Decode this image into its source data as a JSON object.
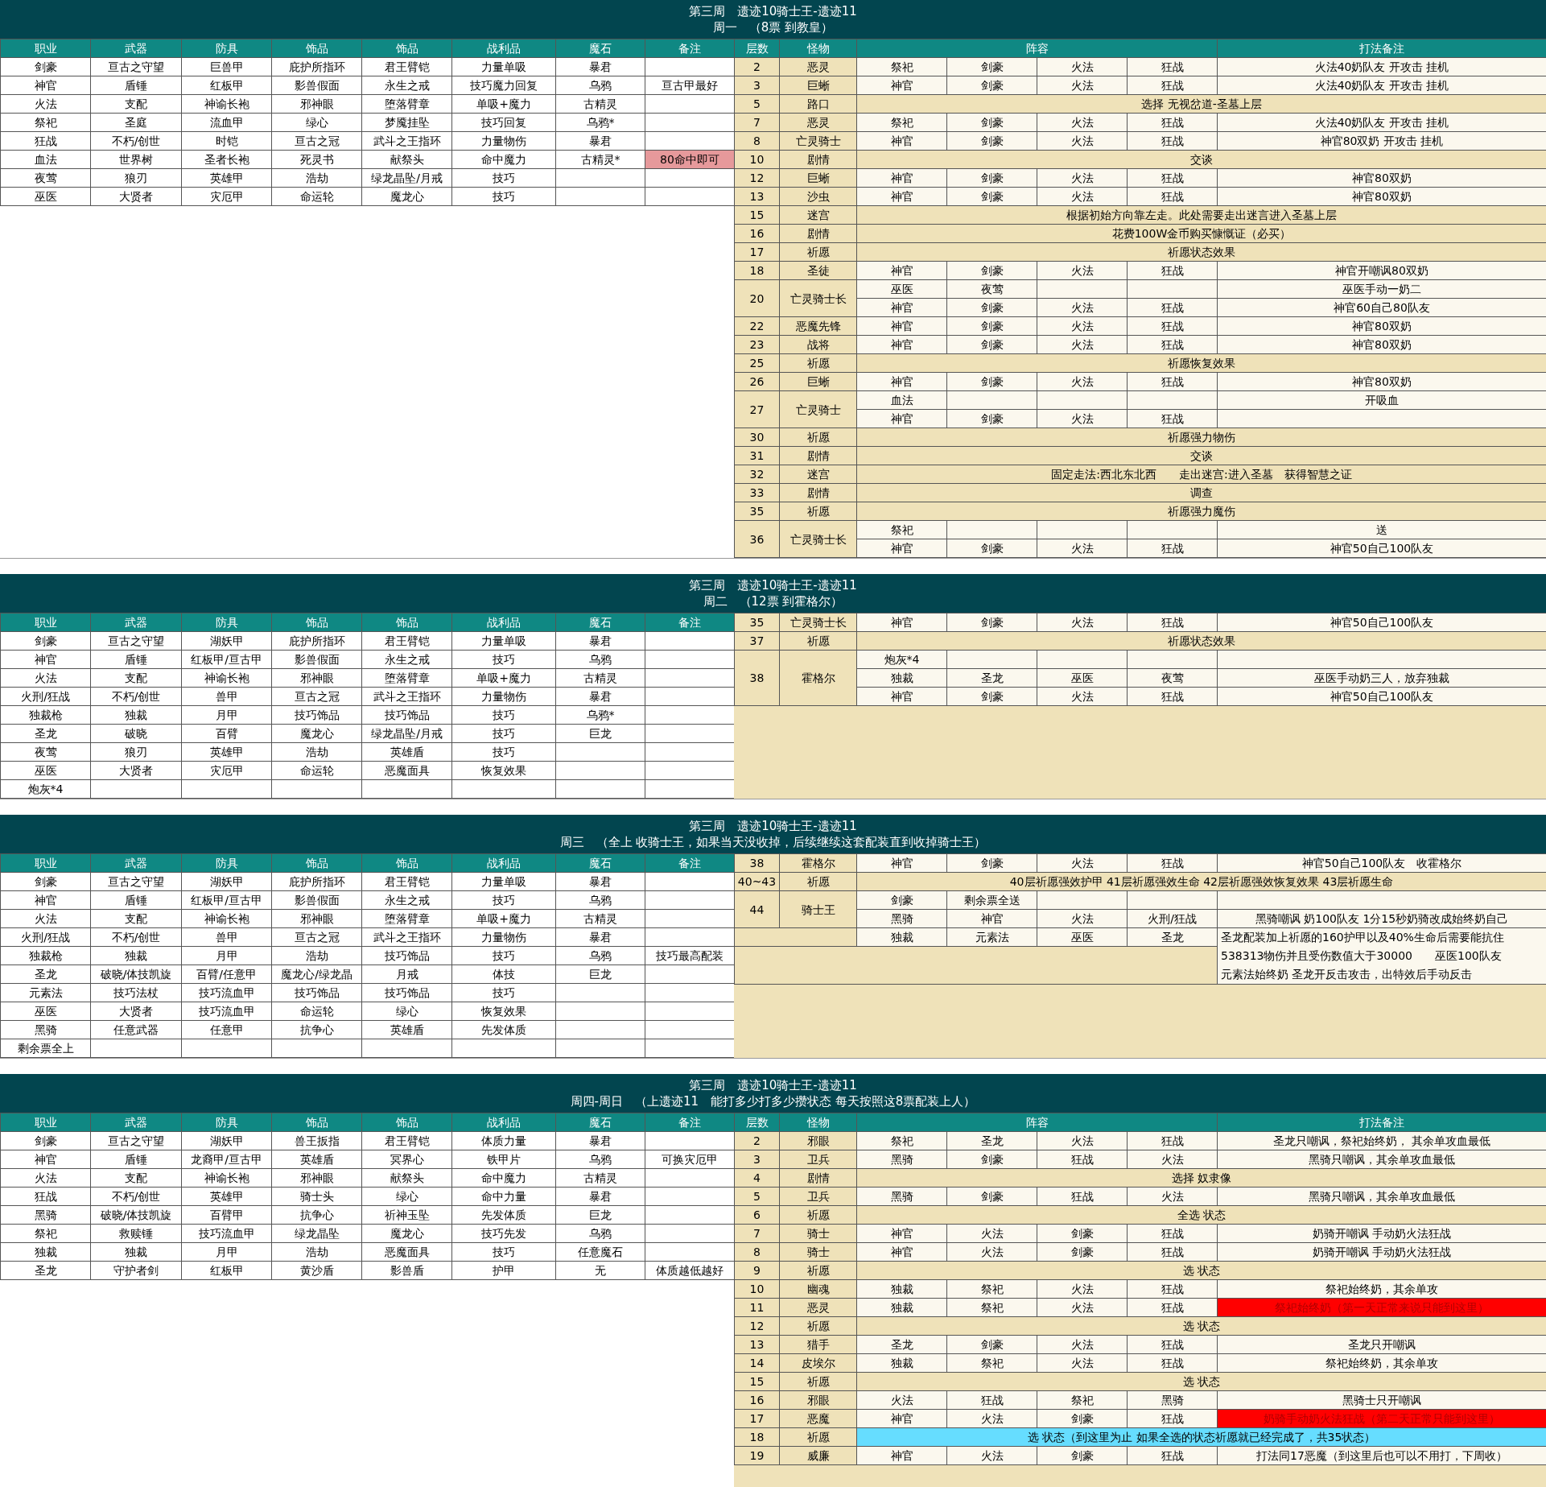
{
  "sections": [
    {
      "title": "第三周　遗迹10骑士王-遗迹11",
      "subtitle": "周一　（8票 到教皇）",
      "gear_columns": [
        "职业",
        "武器",
        "防具",
        "饰品",
        "饰品",
        "战利品",
        "魔石",
        "备注"
      ],
      "gear_rows": [
        {
          "role": "剑豪",
          "weapon": "亘古之守望",
          "armor": "巨兽甲",
          "accessory_1": "庇护所指环",
          "accessory_2": "君王臂铠",
          "loot": "力量单吸",
          "magic_stone": "暴君"
        },
        {
          "role": "神官",
          "weapon": "盾锤",
          "armor": "红板甲",
          "accessory_1": "影兽假面",
          "accessory_2": "永生之戒",
          "loot": "技巧魔力回复",
          "magic_stone": "乌鸦",
          "note": "亘古甲最好"
        },
        {
          "role": "火法",
          "weapon": "支配",
          "armor": "神谕长袍",
          "accessory_1": "邪神眼",
          "accessory_2": "堕落臂章",
          "loot": "单吸+魔力",
          "magic_stone": "古精灵"
        },
        {
          "role": "祭祀",
          "weapon": "圣庭",
          "armor": "流血甲",
          "accessory_1": "绿心",
          "accessory_2": "梦魇挂坠",
          "loot": "技巧回复",
          "magic_stone": "乌鸦*"
        },
        {
          "role": "狂战",
          "weapon": "不朽/创世",
          "armor": "时铠",
          "accessory_1": "亘古之冠",
          "accessory_2": "武斗之王指环",
          "loot": "力量物伤",
          "magic_stone": "暴君"
        },
        {
          "role": "血法",
          "weapon": "世界树",
          "armor": "圣者长袍",
          "accessory_1": "死灵书",
          "accessory_2": "献祭头",
          "loot": "命中魔力",
          "magic_stone": "古精灵*",
          "note": "80命中即可",
          "color": "#e6999b"
        },
        {
          "role": "夜莺",
          "weapon": "狼刃",
          "armor": "英雄甲",
          "accessory_1": "浩劫",
          "accessory_2": "绿龙晶坠/月戒",
          "loot": "技巧"
        },
        {
          "role": "巫医",
          "weapon": "大贤者",
          "armor": "灾厄甲",
          "accessory_1": "命运轮",
          "accessory_2": "魔龙心",
          "loot": "技巧"
        }
      ],
      "floor_columns": [
        "层数",
        "怪物",
        "阵容",
        "打法备注"
      ],
      "floors": [
        {
          "floor": "2",
          "monster": "恶灵",
          "lines": [
            {
              "kind": "team",
              "members": [
                "祭祀",
                "剑豪",
                "火法",
                "狂战"
              ],
              "note": "火法40奶队友 开攻击 挂机"
            }
          ]
        },
        {
          "floor": "3",
          "monster": "巨蜥",
          "lines": [
            {
              "kind": "team",
              "members": [
                "神官",
                "剑豪",
                "火法",
                "狂战"
              ],
              "note": "火法40奶队友 开攻击 挂机"
            }
          ]
        },
        {
          "floor": "5",
          "monster": "路口",
          "lines": [
            {
              "kind": "banner",
              "text": "选择 无视岔道-圣墓上层"
            }
          ]
        },
        {
          "floor": "7",
          "monster": "恶灵",
          "lines": [
            {
              "kind": "team",
              "members": [
                "祭祀",
                "剑豪",
                "火法",
                "狂战"
              ],
              "note": "火法40奶队友 开攻击 挂机"
            }
          ]
        },
        {
          "floor": "8",
          "monster": "亡灵骑士",
          "lines": [
            {
              "kind": "team",
              "members": [
                "神官",
                "剑豪",
                "火法",
                "狂战"
              ],
              "note": "神官80双奶 开攻击 挂机"
            }
          ]
        },
        {
          "floor": "10",
          "monster": "剧情",
          "lines": [
            {
              "kind": "banner",
              "text": "交谈"
            }
          ]
        },
        {
          "floor": "12",
          "monster": "巨蜥",
          "lines": [
            {
              "kind": "team",
              "members": [
                "神官",
                "剑豪",
                "火法",
                "狂战"
              ],
              "note": "神官80双奶"
            }
          ]
        },
        {
          "floor": "13",
          "monster": "沙虫",
          "lines": [
            {
              "kind": "team",
              "members": [
                "神官",
                "剑豪",
                "火法",
                "狂战"
              ],
              "note": "神官80双奶"
            }
          ]
        },
        {
          "floor": "15",
          "monster": "迷宫",
          "lines": [
            {
              "kind": "banner",
              "text": "根据初始方向靠左走。此处需要走出迷言进入圣墓上层"
            }
          ]
        },
        {
          "floor": "16",
          "monster": "剧情",
          "lines": [
            {
              "kind": "banner",
              "text": "花费100W金币购买慷慨证（必买）"
            }
          ]
        },
        {
          "floor": "17",
          "monster": "祈愿",
          "lines": [
            {
              "kind": "banner",
              "text": "祈愿状态效果"
            }
          ]
        },
        {
          "floor": "18",
          "monster": "圣徒",
          "lines": [
            {
              "kind": "team",
              "members": [
                "神官",
                "剑豪",
                "火法",
                "狂战"
              ],
              "note": "神官开嘲讽80双奶"
            }
          ]
        },
        {
          "floor": "20",
          "monster": "亡灵骑士长",
          "lines": [
            {
              "kind": "team",
              "members": [
                "巫医",
                "夜莺"
              ],
              "note": "巫医手动一奶二"
            },
            {
              "kind": "team",
              "members": [
                "神官",
                "剑豪",
                "火法",
                "狂战"
              ],
              "note": "神官60自己80队友"
            }
          ]
        },
        {
          "floor": "22",
          "monster": "恶魔先锋",
          "lines": [
            {
              "kind": "team",
              "members": [
                "神官",
                "剑豪",
                "火法",
                "狂战"
              ],
              "note": "神官80双奶"
            }
          ]
        },
        {
          "floor": "23",
          "monster": "战将",
          "lines": [
            {
              "kind": "team",
              "members": [
                "神官",
                "剑豪",
                "火法",
                "狂战"
              ],
              "note": "神官80双奶"
            }
          ]
        },
        {
          "floor": "25",
          "monster": "祈愿",
          "lines": [
            {
              "kind": "banner",
              "text": "祈愿恢复效果"
            }
          ]
        },
        {
          "floor": "26",
          "monster": "巨蜥",
          "lines": [
            {
              "kind": "team",
              "members": [
                "神官",
                "剑豪",
                "火法",
                "狂战"
              ],
              "note": "神官80双奶"
            }
          ]
        },
        {
          "floor": "27",
          "monster": "亡灵骑士",
          "lines": [
            {
              "kind": "team",
              "members": [
                "血法"
              ],
              "note": "开吸血"
            },
            {
              "kind": "team",
              "members": [
                "神官",
                "剑豪",
                "火法",
                "狂战"
              ]
            }
          ]
        },
        {
          "floor": "30",
          "monster": "祈愿",
          "lines": [
            {
              "kind": "banner",
              "text": "祈愿强力物伤"
            }
          ]
        },
        {
          "floor": "31",
          "monster": "剧情",
          "lines": [
            {
              "kind": "banner",
              "text": "交谈"
            }
          ]
        },
        {
          "floor": "32",
          "monster": "迷宫",
          "lines": [
            {
              "kind": "banner",
              "text": "固定走法:西北东北西　　走出迷宫:进入圣墓　获得智慧之证"
            }
          ]
        },
        {
          "floor": "33",
          "monster": "剧情",
          "lines": [
            {
              "kind": "banner",
              "text": "调查"
            }
          ]
        },
        {
          "floor": "35",
          "monster": "祈愿",
          "lines": [
            {
              "kind": "banner",
              "text": "祈愿强力魔伤"
            }
          ]
        },
        {
          "floor": "36",
          "monster": "亡灵骑士长",
          "lines": [
            {
              "kind": "team",
              "members": [
                "祭祀"
              ],
              "note": "送"
            },
            {
              "kind": "team",
              "members": [
                "神官",
                "剑豪",
                "火法",
                "狂战"
              ],
              "note": "神官50自己100队友"
            }
          ]
        }
      ]
    },
    {
      "title": "第三周　遗迹10骑士王-遗迹11",
      "subtitle": "周二　（12票 到霍格尔）",
      "gear_columns": [
        "职业",
        "武器",
        "防具",
        "饰品",
        "饰品",
        "战利品",
        "魔石",
        "备注"
      ],
      "gear_rows": [
        {
          "role": "剑豪",
          "weapon": "亘古之守望",
          "armor": "湖妖甲",
          "accessory_1": "庇护所指环",
          "accessory_2": "君王臂铠",
          "loot": "力量单吸",
          "magic_stone": "暴君"
        },
        {
          "role": "神官",
          "weapon": "盾锤",
          "armor": "红板甲/亘古甲",
          "accessory_1": "影兽假面",
          "accessory_2": "永生之戒",
          "loot": "技巧",
          "magic_stone": "乌鸦"
        },
        {
          "role": "火法",
          "weapon": "支配",
          "armor": "神谕长袍",
          "accessory_1": "邪神眼",
          "accessory_2": "堕落臂章",
          "loot": "单吸+魔力",
          "magic_stone": "古精灵"
        },
        {
          "role": "火刑/狂战",
          "weapon": "不朽/创世",
          "armor": "兽甲",
          "accessory_1": "亘古之冠",
          "accessory_2": "武斗之王指环",
          "loot": "力量物伤",
          "magic_stone": "暴君"
        },
        {
          "role": "独裁枪",
          "weapon": "独裁",
          "armor": "月甲",
          "accessory_1": "技巧饰品",
          "accessory_2": "技巧饰品",
          "loot": "技巧",
          "magic_stone": "乌鸦*"
        },
        {
          "role": "圣龙",
          "weapon": "破晓",
          "armor": "百臂",
          "accessory_1": "魔龙心",
          "accessory_2": "绿龙晶坠/月戒",
          "loot": "技巧",
          "magic_stone": "巨龙"
        },
        {
          "role": "夜莺",
          "weapon": "狼刃",
          "armor": "英雄甲",
          "accessory_1": "浩劫",
          "accessory_2": "英雄盾",
          "loot": "技巧"
        },
        {
          "role": "巫医",
          "weapon": "大贤者",
          "armor": "灾厄甲",
          "accessory_1": "命运轮",
          "accessory_2": "恶魔面具",
          "loot": "恢复效果"
        },
        {
          "role": "炮灰*4"
        }
      ],
      "floors": [
        {
          "floor": "35",
          "monster": "亡灵骑士长",
          "lines": [
            {
              "kind": "team",
              "members": [
                "神官",
                "剑豪",
                "火法",
                "狂战"
              ],
              "note": "神官50自己100队友"
            }
          ]
        },
        {
          "floor": "37",
          "monster": "祈愿",
          "lines": [
            {
              "kind": "banner",
              "text": "祈愿状态效果"
            }
          ]
        },
        {
          "floor": "38",
          "monster": "霍格尔",
          "lines": [
            {
              "kind": "team",
              "members": [
                "炮灰*4"
              ]
            },
            {
              "kind": "team",
              "members": [
                "独裁",
                "圣龙",
                "巫医",
                "夜莺"
              ],
              "note": "巫医手动奶三人，放弃独裁"
            },
            {
              "kind": "team",
              "members": [
                "神官",
                "剑豪",
                "火法",
                "狂战"
              ],
              "note": "神官50自己100队友"
            }
          ]
        }
      ]
    },
    {
      "title": "第三周　遗迹10骑士王-遗迹11",
      "subtitle": "周三　（全上 收骑士王，如果当天没收掉，后续继续这套配装直到收掉骑士王）",
      "gear_columns": [
        "职业",
        "武器",
        "防具",
        "饰品",
        "饰品",
        "战利品",
        "魔石",
        "备注"
      ],
      "gear_rows": [
        {
          "role": "剑豪",
          "weapon": "亘古之守望",
          "armor": "湖妖甲",
          "accessory_1": "庇护所指环",
          "accessory_2": "君王臂铠",
          "loot": "力量单吸",
          "magic_stone": "暴君"
        },
        {
          "role": "神官",
          "weapon": "盾锤",
          "armor": "红板甲/亘古甲",
          "accessory_1": "影兽假面",
          "accessory_2": "永生之戒",
          "loot": "技巧",
          "magic_stone": "乌鸦"
        },
        {
          "role": "火法",
          "weapon": "支配",
          "armor": "神谕长袍",
          "accessory_1": "邪神眼",
          "accessory_2": "堕落臂章",
          "loot": "单吸+魔力",
          "magic_stone": "古精灵"
        },
        {
          "role": "火刑/狂战",
          "weapon": "不朽/创世",
          "armor": "兽甲",
          "accessory_1": "亘古之冠",
          "accessory_2": "武斗之王指环",
          "loot": "力量物伤",
          "magic_stone": "暴君"
        },
        {
          "role": "独裁枪",
          "weapon": "独裁",
          "armor": "月甲",
          "accessory_1": "浩劫",
          "accessory_2": "技巧饰品",
          "loot": "技巧",
          "magic_stone": "乌鸦",
          "note": "技巧最高配装"
        },
        {
          "role": "圣龙",
          "weapon": "破晓/体技凯旋",
          "armor": "百臂/任意甲",
          "accessory_1": "魔龙心/绿龙晶",
          "accessory_2": "月戒",
          "loot": "体技",
          "magic_stone": "巨龙"
        },
        {
          "role": "元素法",
          "weapon": "技巧法杖",
          "armor": "技巧流血甲",
          "accessory_1": "技巧饰品",
          "accessory_2": "技巧饰品",
          "loot": "技巧"
        },
        {
          "role": "巫医",
          "weapon": "大贤者",
          "armor": "技巧流血甲",
          "accessory_1": "命运轮",
          "accessory_2": "绿心",
          "loot": "恢复效果"
        },
        {
          "role": "黑骑",
          "weapon": "任意武器",
          "armor": "任意甲",
          "accessory_1": "抗争心",
          "accessory_2": "英雄盾",
          "loot": "先发体质"
        },
        {
          "role": "剩余票全上"
        }
      ],
      "floors": [
        {
          "floor": "38",
          "monster": "霍格尔",
          "lines": [
            {
              "kind": "team",
              "members": [
                "神官",
                "剑豪",
                "火法",
                "狂战"
              ],
              "note": "神官50自己100队友　收霍格尔"
            }
          ]
        },
        {
          "floor": "40~43",
          "monster": "祈愿",
          "lines": [
            {
              "kind": "banner",
              "text": "40层祈愿强效护甲 41层祈愿强效生命 42层祈愿强效恢复效果 43层祈愿生命"
            }
          ]
        },
        {
          "floor": "44",
          "monster": "骑士王",
          "lines": [
            {
              "kind": "team",
              "members": [
                "剑豪",
                "剩余票全送"
              ]
            },
            {
              "kind": "team",
              "members": [
                "黑骑",
                "神官",
                "火法",
                "火刑/狂战"
              ],
              "note": "黑骑嘲讽 奶100队友 1分15秒奶骑改成始终奶自己"
            }
          ]
        },
        {
          "lines": [
            {
              "kind": "team",
              "members": [
                "独裁",
                "元素法",
                "巫医",
                "圣龙"
              ],
              "note_lines": [
                "圣龙配装加上祈愿的160护甲以及40%生命后需要能抗住",
                "538313物伤并且受伤数值大于30000　　巫医100队友",
                "元素法始终奶 圣龙开反击攻击，出特效后手动反击"
              ]
            }
          ]
        }
      ]
    },
    {
      "title": "第三周　遗迹10骑士王-遗迹11",
      "subtitle": "周四-周日　（上遗迹11　能打多少打多少攒状态 每天按照这8票配装上人）",
      "gear_columns": [
        "职业",
        "武器",
        "防具",
        "饰品",
        "饰品",
        "战利品",
        "魔石",
        "备注"
      ],
      "gear_rows": [
        {
          "role": "剑豪",
          "weapon": "亘古之守望",
          "armor": "湖妖甲",
          "accessory_1": "兽王扳指",
          "accessory_2": "君王臂铠",
          "loot": "体质力量",
          "magic_stone": "暴君"
        },
        {
          "role": "神官",
          "weapon": "盾锤",
          "armor": "龙裔甲/亘古甲",
          "accessory_1": "英雄盾",
          "accessory_2": "冥界心",
          "loot": "铁甲片",
          "magic_stone": "乌鸦",
          "note": "可换灾厄甲"
        },
        {
          "role": "火法",
          "weapon": "支配",
          "armor": "神谕长袍",
          "accessory_1": "邪神眼",
          "accessory_2": "献祭头",
          "loot": "命中魔力",
          "magic_stone": "古精灵"
        },
        {
          "role": "狂战",
          "weapon": "不朽/创世",
          "armor": "英雄甲",
          "accessory_1": "骑士头",
          "accessory_2": "绿心",
          "loot": "命中力量",
          "magic_stone": "暴君"
        },
        {
          "role": "黑骑",
          "weapon": "破晓/体技凯旋",
          "armor": "百臂甲",
          "accessory_1": "抗争心",
          "accessory_2": "祈神玉坠",
          "loot": "先发体质",
          "magic_stone": "巨龙"
        },
        {
          "role": "祭祀",
          "weapon": "救赎锤",
          "armor": "技巧流血甲",
          "accessory_1": "绿龙晶坠",
          "accessory_2": "魔龙心",
          "loot": "技巧先发",
          "magic_stone": "乌鸦"
        },
        {
          "role": "独裁",
          "weapon": "独裁",
          "armor": "月甲",
          "accessory_1": "浩劫",
          "accessory_2": "恶魔面具",
          "loot": "技巧",
          "magic_stone": "任意魔石"
        },
        {
          "role": "圣龙",
          "weapon": "守护者剑",
          "armor": "红板甲",
          "accessory_1": "黄沙盾",
          "accessory_2": "影兽盾",
          "loot": "护甲",
          "magic_stone": "无",
          "note": "体质越低越好"
        }
      ],
      "floor_columns": [
        "层数",
        "怪物",
        "阵容",
        "打法备注"
      ],
      "floors": [
        {
          "floor": "2",
          "monster": "邪眼",
          "lines": [
            {
              "kind": "team",
              "members": [
                "祭祀",
                "圣龙",
                "火法",
                "狂战"
              ],
              "note": "圣龙只嘲讽，祭祀始终奶， 其余单攻血最低"
            }
          ]
        },
        {
          "floor": "3",
          "monster": "卫兵",
          "lines": [
            {
              "kind": "team",
              "members": [
                "黑骑",
                "剑豪",
                "狂战",
                "火法"
              ],
              "note": "黑骑只嘲讽，其余单攻血最低"
            }
          ]
        },
        {
          "floor": "4",
          "monster": "剧情",
          "lines": [
            {
              "kind": "banner",
              "text": "选择  奴隶像"
            }
          ]
        },
        {
          "floor": "5",
          "monster": "卫兵",
          "lines": [
            {
              "kind": "team",
              "members": [
                "黑骑",
                "剑豪",
                "狂战",
                "火法"
              ],
              "note": "黑骑只嘲讽，其余单攻血最低"
            }
          ]
        },
        {
          "floor": "6",
          "monster": "祈愿",
          "lines": [
            {
              "kind": "banner",
              "text": "全选 状态"
            }
          ]
        },
        {
          "floor": "7",
          "monster": "骑士",
          "lines": [
            {
              "kind": "team",
              "members": [
                "神官",
                "火法",
                "剑豪",
                "狂战"
              ],
              "note": "奶骑开嘲讽 手动奶火法狂战"
            }
          ]
        },
        {
          "floor": "8",
          "monster": "骑士",
          "lines": [
            {
              "kind": "team",
              "members": [
                "神官",
                "火法",
                "剑豪",
                "狂战"
              ],
              "note": "奶骑开嘲讽 手动奶火法狂战"
            }
          ]
        },
        {
          "floor": "9",
          "monster": "祈愿",
          "lines": [
            {
              "kind": "banner",
              "text": "选 状态"
            }
          ]
        },
        {
          "floor": "10",
          "monster": "幽魂",
          "lines": [
            {
              "kind": "team",
              "members": [
                "独裁",
                "祭祀",
                "火法",
                "狂战"
              ],
              "note": "祭祀始终奶，其余单攻"
            }
          ]
        },
        {
          "floor": "11",
          "monster": "恶灵",
          "lines": [
            {
              "kind": "team",
              "members": [
                "独裁",
                "祭祀",
                "火法",
                "狂战"
              ],
              "note": "祭祀始终奶（第一天正常来说只能到这里）",
              "color": "#ff0000",
              "urgent": true
            }
          ]
        },
        {
          "floor": "12",
          "monster": "祈愿",
          "lines": [
            {
              "kind": "banner",
              "text": "选 状态"
            }
          ]
        },
        {
          "floor": "13",
          "monster": "猎手",
          "lines": [
            {
              "kind": "team",
              "members": [
                "圣龙",
                "剑豪",
                "火法",
                "狂战"
              ],
              "note": "圣龙只开嘲讽"
            }
          ]
        },
        {
          "floor": "14",
          "monster": "皮埃尔",
          "lines": [
            {
              "kind": "team",
              "members": [
                "独裁",
                "祭祀",
                "火法",
                "狂战"
              ],
              "note": "祭祀始终奶，其余单攻"
            }
          ]
        },
        {
          "floor": "15",
          "monster": "祈愿",
          "lines": [
            {
              "kind": "banner",
              "text": "选 状态"
            }
          ]
        },
        {
          "floor": "16",
          "monster": "邪眼",
          "lines": [
            {
              "kind": "team",
              "members": [
                "火法",
                "狂战",
                "祭祀",
                "黑骑"
              ],
              "note": "黑骑士只开嘲讽"
            }
          ]
        },
        {
          "floor": "17",
          "monster": "恶魔",
          "lines": [
            {
              "kind": "team",
              "members": [
                "神官",
                "火法",
                "剑豪",
                "狂战"
              ],
              "note": "奶骑手动奶火法狂战（第二天正常只能到这里）",
              "color": "#ff0000",
              "urgent": true
            }
          ]
        },
        {
          "floor": "18",
          "monster": "祈愿",
          "lines": [
            {
              "kind": "banner",
              "text": "选 状态（到这里为止 如果全选的状态祈愿就已经完成了，共35状态）",
              "color": "#66ddff"
            }
          ]
        },
        {
          "floor": "19",
          "monster": "威廉",
          "lines": [
            {
              "kind": "team",
              "members": [
                "神官",
                "火法",
                "剑豪",
                "狂战"
              ],
              "note": "打法同17恶魔（到这里后也可以不用打，下周收）"
            }
          ]
        }
      ]
    }
  ]
}
